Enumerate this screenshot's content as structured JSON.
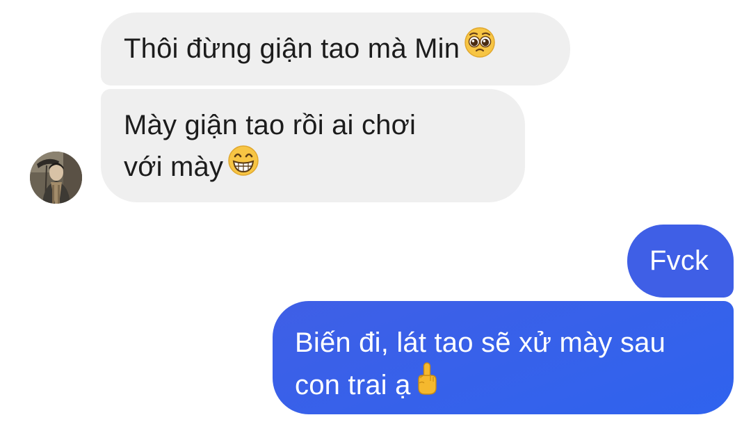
{
  "conversation": {
    "messages": [
      {
        "sender": "contact",
        "lines": [
          "Thôi đừng giận tao mà Min"
        ],
        "emoji": "pleading-face-icon"
      },
      {
        "sender": "contact",
        "lines": [
          "Mày giận tao rồi ai chơi",
          "với mày"
        ],
        "emoji": "grinning-face-icon"
      },
      {
        "sender": "me",
        "lines": [
          "Fvck"
        ]
      },
      {
        "sender": "me",
        "lines": [
          "Biến đi, lát tao sẽ xử mày sau",
          "con trai ạ"
        ],
        "emoji": "middle-finger-icon"
      }
    ]
  },
  "colors": {
    "incoming_bubble": "#efefef",
    "outgoing_bubble": "#3f5fe6",
    "incoming_text": "#1c1c1c",
    "outgoing_text": "#ffffff"
  }
}
